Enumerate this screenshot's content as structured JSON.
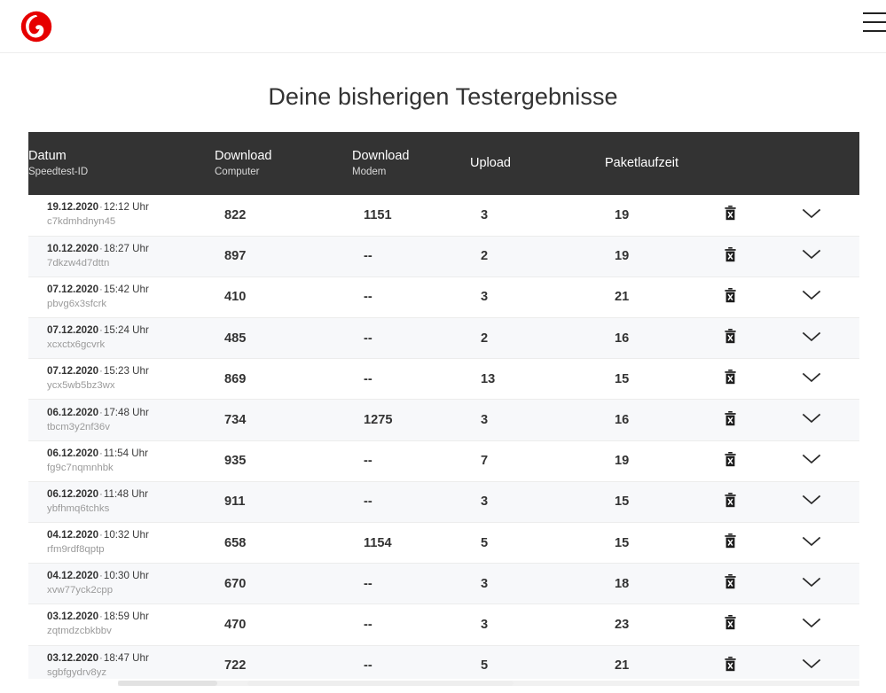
{
  "brand": {
    "logo_name": "vodafone-logo",
    "accent_color": "#e60000",
    "header_bg": "#ffffff"
  },
  "header": {
    "menu_label": "Menü",
    "menu_icon": "hamburger-menu-icon"
  },
  "page": {
    "title": "Deine bisherigen Testergebnisse"
  },
  "table": {
    "header_bg": "#333333",
    "columns": [
      {
        "main": "Datum",
        "sub": "Speedtest-ID"
      },
      {
        "main": "Download",
        "sub": "Computer"
      },
      {
        "main": "Download",
        "sub": "Modem"
      },
      {
        "main": "Upload",
        "sub": ""
      },
      {
        "main": "Paketlaufzeit",
        "sub": ""
      },
      {
        "main": "",
        "sub": ""
      },
      {
        "main": "",
        "sub": ""
      }
    ],
    "row_actions": {
      "delete_icon": "trash-delete-icon",
      "delete_label": "Löschen",
      "expand_icon": "chevron-down-icon",
      "expand_label": "Details anzeigen"
    },
    "rows": [
      {
        "date": "19.12.2020",
        "sep": "·",
        "time": "12:12 Uhr",
        "id": "c7kdmhdnyn45",
        "download_computer": "822",
        "download_modem": "1151",
        "upload": "3",
        "paketlaufzeit": "19"
      },
      {
        "date": "10.12.2020",
        "sep": "·",
        "time": "18:27 Uhr",
        "id": "7dkzw4d7dttn",
        "download_computer": "897",
        "download_modem": "--",
        "upload": "2",
        "paketlaufzeit": "19"
      },
      {
        "date": "07.12.2020",
        "sep": "·",
        "time": "15:42 Uhr",
        "id": "pbvg6x3sfcrk",
        "download_computer": "410",
        "download_modem": "--",
        "upload": "3",
        "paketlaufzeit": "21"
      },
      {
        "date": "07.12.2020",
        "sep": "·",
        "time": "15:24 Uhr",
        "id": "xcxctx6gcvrk",
        "download_computer": "485",
        "download_modem": "--",
        "upload": "2",
        "paketlaufzeit": "16"
      },
      {
        "date": "07.12.2020",
        "sep": "·",
        "time": "15:23 Uhr",
        "id": "ycx5wb5bz3wx",
        "download_computer": "869",
        "download_modem": "--",
        "upload": "13",
        "paketlaufzeit": "15"
      },
      {
        "date": "06.12.2020",
        "sep": "·",
        "time": "17:48 Uhr",
        "id": "tbcm3y2nf36v",
        "download_computer": "734",
        "download_modem": "1275",
        "upload": "3",
        "paketlaufzeit": "16"
      },
      {
        "date": "06.12.2020",
        "sep": "·",
        "time": "11:54 Uhr",
        "id": "fg9c7nqmnhbk",
        "download_computer": "935",
        "download_modem": "--",
        "upload": "7",
        "paketlaufzeit": "19"
      },
      {
        "date": "06.12.2020",
        "sep": "·",
        "time": "11:48 Uhr",
        "id": "ybfhmq6tchks",
        "download_computer": "911",
        "download_modem": "--",
        "upload": "3",
        "paketlaufzeit": "15"
      },
      {
        "date": "04.12.2020",
        "sep": "·",
        "time": "10:32 Uhr",
        "id": "rfm9rdf8qptp",
        "download_computer": "658",
        "download_modem": "1154",
        "upload": "5",
        "paketlaufzeit": "15"
      },
      {
        "date": "04.12.2020",
        "sep": "·",
        "time": "10:30 Uhr",
        "id": "xvw77yck2cpp",
        "download_computer": "670",
        "download_modem": "--",
        "upload": "3",
        "paketlaufzeit": "18"
      },
      {
        "date": "03.12.2020",
        "sep": "·",
        "time": "18:59 Uhr",
        "id": "zqtmdzcbkbbv",
        "download_computer": "470",
        "download_modem": "--",
        "upload": "3",
        "paketlaufzeit": "23"
      },
      {
        "date": "03.12.2020",
        "sep": "·",
        "time": "18:47 Uhr",
        "id": "sgbfgydrv8yz",
        "download_computer": "722",
        "download_modem": "--",
        "upload": "5",
        "paketlaufzeit": "21"
      }
    ]
  }
}
